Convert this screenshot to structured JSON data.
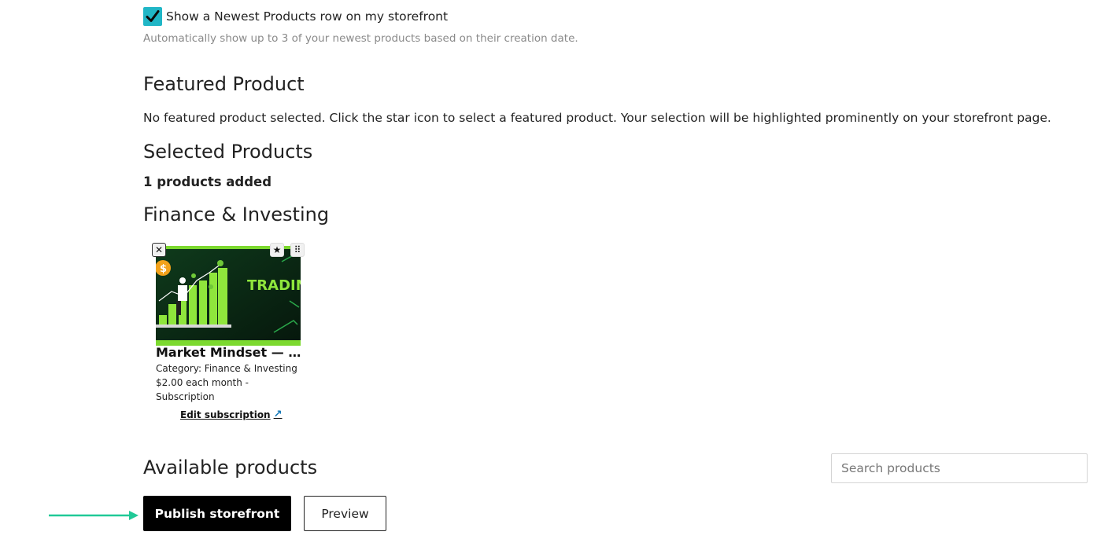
{
  "newest_products": {
    "checked": true,
    "label": "Show a Newest Products row on my storefront",
    "helper": "Automatically show up to 3 of your newest products based on their creation date."
  },
  "featured": {
    "heading": "Featured Product",
    "message": "No featured product selected. Click the star icon to select a featured product. Your selection will be highlighted prominently on your storefront page."
  },
  "selected": {
    "heading": "Selected Products",
    "count_text": "1 products added"
  },
  "category_group": {
    "heading": "Finance & Investing",
    "products": [
      {
        "image_text": "TRADING",
        "title": "Market Mindset — A...",
        "category": "Category: Finance & Investing",
        "price_line1": "$2.00 each month -",
        "price_line2": "Subscription",
        "edit_label": "Edit subscription"
      }
    ]
  },
  "available": {
    "heading": "Available products",
    "search_placeholder": "Search products"
  },
  "actions": {
    "publish_label": "Publish storefront",
    "preview_label": "Preview"
  },
  "colors": {
    "checkbox": "#20b6c6",
    "arrow": "#20c997",
    "link_icon": "#1478b8"
  }
}
